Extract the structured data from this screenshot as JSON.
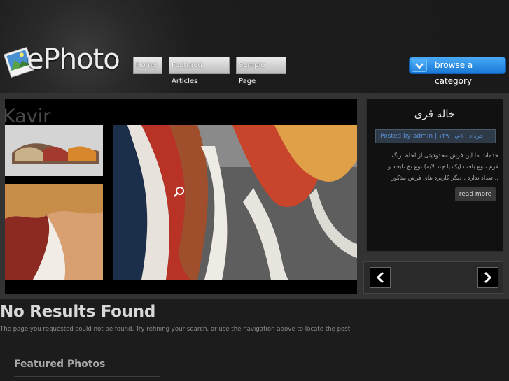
{
  "site": {
    "logo_text": "ePhoto"
  },
  "nav": {
    "items": [
      "Home",
      "Featured Articles",
      "Sample Page"
    ]
  },
  "browse": {
    "label": "browse a category"
  },
  "slider": {
    "slide_title": "Kavir",
    "post_title": "خاله قزی",
    "meta": "Posted by admin | خرداد ۱۰م، ۱۳۹۰",
    "excerpt": "خدمات ما این فرش محدودیتی از لحاظ رنگ،\nفرم ،نوع بافت (یک یا چند لایه) نوع نخ ،ابعاد و\n...تعداد ندارد .  دیگر کاربرد های فرش مذکور",
    "read_more": "read more"
  },
  "content": {
    "heading": "No Results Found",
    "message": "The page you requested could not be found. Try refining your search, or use the navigation above to locate the post.",
    "featured_heading": "Featured Photos"
  }
}
